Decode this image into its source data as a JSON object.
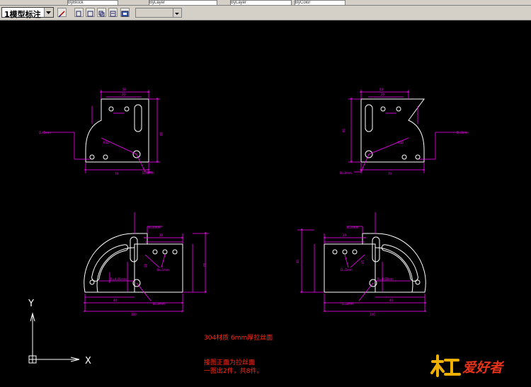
{
  "toolbar": {
    "top_strip_items": [
      "ByBlock",
      "ByLayer",
      "ByLayer",
      "ByColor"
    ],
    "text_style_value": "1模型标注",
    "layer_value": ""
  },
  "drawing": {
    "dims": {
      "top_left": {
        "w50": "50",
        "w20": "20",
        "w70": "70",
        "h80": "80",
        "r": "R50",
        "dia_small": "D=5mm",
        "dia_big": "D=8mm"
      },
      "top_right": {
        "w50": "50",
        "w20": "20",
        "w70": "70",
        "h80": "80",
        "r": "R50",
        "dia_small": "D=5mm",
        "dia_big": "D=8mm"
      },
      "bot_left": {
        "slot": "R=4mm",
        "d5": "D=5mm",
        "d8": "D=8mm",
        "r401": "R=4.01mm",
        "w40": "40",
        "w100": "100",
        "w20": "20",
        "h45": "45",
        "h40": "40"
      },
      "bot_right": {
        "slot": "R=4mm",
        "d5": "D=5mm",
        "d8": "D=8mm",
        "r401": "R=4.01mm",
        "w40": "40",
        "w100": "100",
        "w20": "20",
        "h45": "45",
        "h40": "40"
      }
    },
    "axis_y": "Y",
    "axis_x": "X"
  },
  "notes": {
    "line1": "304材质 6mm厚拉丝面",
    "line2": "接图正面为拉丝面",
    "line3": "一图出2件，共8件。"
  },
  "logo": {
    "text": "爱好者",
    "colors": {
      "accent": "#e6331a",
      "wood": "#f0b000"
    }
  }
}
